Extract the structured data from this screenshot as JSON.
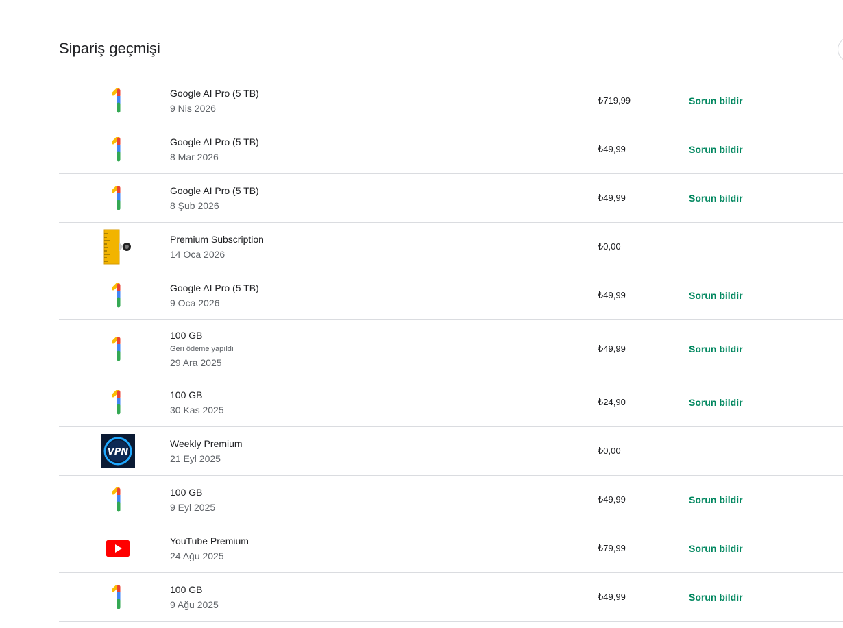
{
  "header": {
    "title": "Sipariş geçmişi"
  },
  "orders": [
    {
      "icon": "google-one-icon",
      "title": "Google AI Pro (5 TB)",
      "note": "",
      "date": "9 Nis 2026",
      "price": "₺719,99",
      "action": "Sorun bildir"
    },
    {
      "icon": "google-one-icon",
      "title": "Google AI Pro (5 TB)",
      "note": "",
      "date": "8 Mar 2026",
      "price": "₺49,99",
      "action": "Sorun bildir"
    },
    {
      "icon": "google-one-icon",
      "title": "Google AI Pro (5 TB)",
      "note": "",
      "date": "8 Şub 2026",
      "price": "₺49,99",
      "action": "Sorun bildir"
    },
    {
      "icon": "ruler-app-icon",
      "title": "Premium Subscription",
      "note": "",
      "date": "14 Oca 2026",
      "price": "₺0,00",
      "action": ""
    },
    {
      "icon": "google-one-icon",
      "title": "Google AI Pro (5 TB)",
      "note": "",
      "date": "9 Oca 2026",
      "price": "₺49,99",
      "action": "Sorun bildir"
    },
    {
      "icon": "google-one-icon",
      "title": "100 GB",
      "note": "Geri ödeme yapıldı",
      "date": "29 Ara 2025",
      "price": "₺49,99",
      "action": "Sorun bildir"
    },
    {
      "icon": "google-one-icon",
      "title": "100 GB",
      "note": "",
      "date": "30 Kas 2025",
      "price": "₺24,90",
      "action": "Sorun bildir"
    },
    {
      "icon": "vpn-app-icon",
      "title": "Weekly Premium",
      "note": "",
      "date": "21 Eyl 2025",
      "price": "₺0,00",
      "action": ""
    },
    {
      "icon": "google-one-icon",
      "title": "100 GB",
      "note": "",
      "date": "9 Eyl 2025",
      "price": "₺49,99",
      "action": "Sorun bildir"
    },
    {
      "icon": "youtube-icon",
      "title": "YouTube Premium",
      "note": "",
      "date": "24 Ağu 2025",
      "price": "₺79,99",
      "action": "Sorun bildir"
    },
    {
      "icon": "google-one-icon",
      "title": "100 GB",
      "note": "",
      "date": "9 Ağu 2025",
      "price": "₺49,99",
      "action": "Sorun bildir"
    }
  ],
  "colors": {
    "link": "#01875f",
    "divider": "#dadce0",
    "text": "#202124",
    "secondary": "#5f6368"
  }
}
